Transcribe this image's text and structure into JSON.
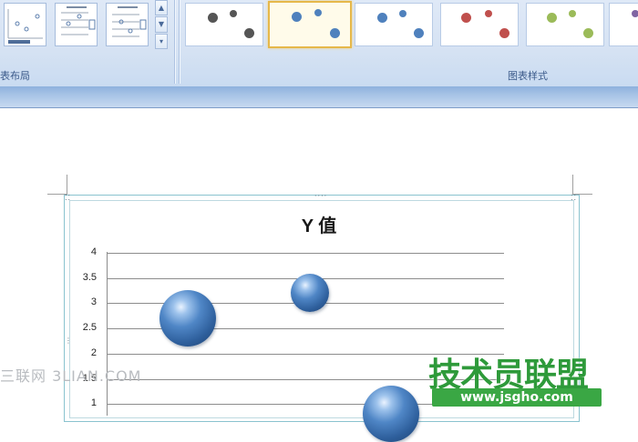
{
  "ribbon": {
    "groups": [
      {
        "label": "表布局"
      },
      {
        "label": "图表样式"
      }
    ],
    "scroll_icons": [
      "scroll-up-icon",
      "scroll-down-icon",
      "more-icon"
    ],
    "style_colors": [
      "#555555",
      "#4f81bd",
      "#4f81bd",
      "#c0504d",
      "#9bbb59",
      "#8064a2"
    ],
    "selected_style_index": 1
  },
  "watermarks": {
    "left": "三联网 3LIAN.COM",
    "brand_name": "技术员联盟",
    "brand_url": "www.jsgho.com"
  },
  "chart_data": {
    "type": "scatter",
    "title": "Y 值",
    "y_ticks": [
      "4",
      "3.5",
      "3",
      "2.5",
      "2",
      "1.5",
      "1"
    ],
    "ylim": [
      1,
      4
    ],
    "grid": true,
    "series": [
      {
        "values": [
          {
            "x": 1,
            "y": 2.7,
            "size": 3
          },
          {
            "x": 2.5,
            "y": 3.2,
            "size": 2
          },
          {
            "x": 3.5,
            "y": 0.8,
            "size": 3
          }
        ]
      }
    ],
    "bubble_color": "#4f81bd"
  }
}
